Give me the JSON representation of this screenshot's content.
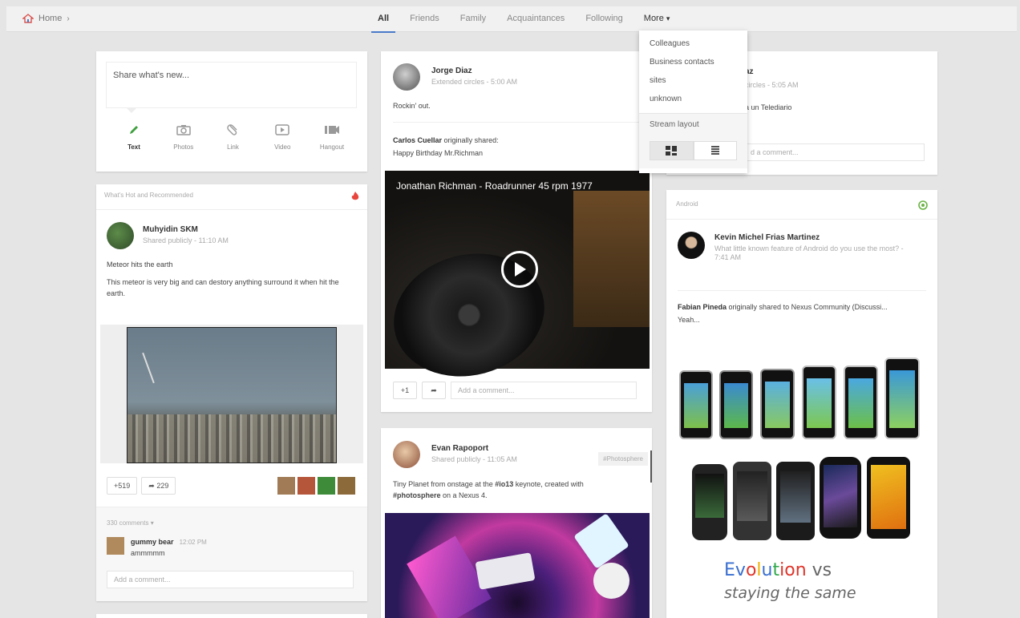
{
  "nav": {
    "home_label": "Home",
    "tabs": [
      "All",
      "Friends",
      "Family",
      "Acquaintances",
      "Following"
    ],
    "more_label": "More"
  },
  "menu": {
    "items": [
      "Colleagues",
      "Business contacts",
      "sites",
      "unknown"
    ],
    "stream_layout_label": "Stream layout"
  },
  "share": {
    "placeholder": "Share what's new...",
    "tools": [
      "Text",
      "Photos",
      "Link",
      "Video",
      "Hangout"
    ]
  },
  "hot": {
    "section_label": "What's Hot and Recommended",
    "author": "Muhyidin SKM",
    "meta": "Shared publicly  -  11:10 AM",
    "line1": "Meteor hits the earth",
    "line2": "This meteor is very big and can destory anything surround it when hit the earth.",
    "plus_count": "+519",
    "share_count": "229",
    "comments_count": "330 comments",
    "commenter": "gummy bear",
    "comment_time": "12:02 PM",
    "comment_text": "ammmmm",
    "add_comment": "Add a comment..."
  },
  "jorge": {
    "author": "Jorge Diaz",
    "meta": "Extended circles  -  5:00 AM",
    "text": "Rockin' out.",
    "reshare_name": "Carlos Cuellar",
    "reshare_suffix": "originally shared:",
    "reshare_text": "Happy Birthday Mr.Richman",
    "video_title": "Jonathan Richman - Roadrunner 45 rpm 1977",
    "plus_label": "+1",
    "add_comment": "Add a comment..."
  },
  "evan": {
    "author": "Evan Rapoport",
    "meta": "Shared publicly  -  11:05 AM",
    "tag": "#Photosphere",
    "text_a": "Tiny Planet from onstage at the ",
    "text_b": "#io13",
    "text_c": " keynote, created with ",
    "text_d": "#photosphere",
    "text_e": " on a Nexus 4."
  },
  "third": {
    "author_partial": "az",
    "meta_partial": "circles  -  5:05 AM",
    "text_partial": "a un Telediario",
    "add_comment_partial": "d a comment..."
  },
  "android": {
    "section_label": "Android",
    "author": "Kevin Michel Frias Martinez",
    "meta": "What little known feature of Android do you use the most?  -",
    "meta_time": "7:41 AM",
    "reshare_name": "Fabian Pineda",
    "reshare_text": "originally shared to Nexus Community (Discussi...",
    "reshare_reply": "Yeah...",
    "evo_letters": [
      "E",
      "v",
      "o",
      "l",
      "u",
      "t",
      "i",
      "o",
      "n"
    ],
    "evo_suffix": " vs",
    "evo_line2": "staying the same"
  },
  "colors": {
    "accent": "#4a7ac9",
    "text_icon_green": "#3f9f3f",
    "hot_red": "#e8453c",
    "android_green": "#6ab344"
  }
}
